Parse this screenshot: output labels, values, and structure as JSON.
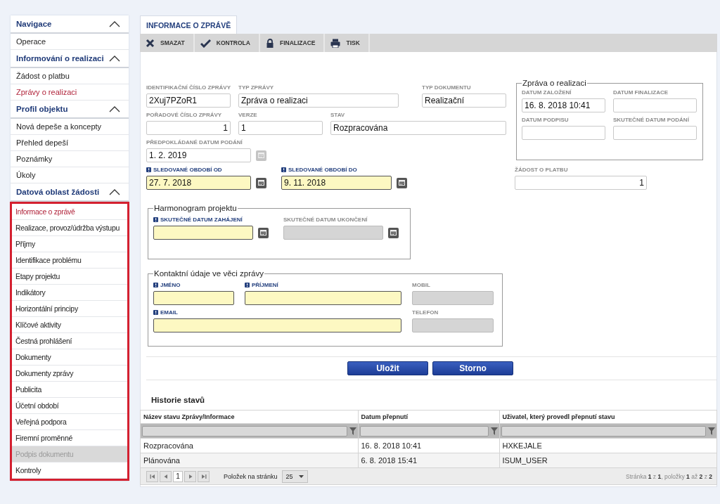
{
  "sidebar": {
    "sections": [
      {
        "title": "Navigace",
        "expanded": true,
        "highlighted": false,
        "items": [
          {
            "label": "Operace",
            "selected": false,
            "disabled": false
          }
        ]
      },
      {
        "title": "Informování o realizaci",
        "expanded": true,
        "highlighted": false,
        "items": [
          {
            "label": "Žádost o platbu",
            "selected": false,
            "disabled": false
          },
          {
            "label": "Zprávy o realizaci",
            "selected": true,
            "disabled": false
          }
        ]
      },
      {
        "title": "Profil objektu",
        "expanded": true,
        "highlighted": false,
        "items": [
          {
            "label": "Nová depeše a koncepty",
            "selected": false,
            "disabled": false
          },
          {
            "label": "Přehled depeší",
            "selected": false,
            "disabled": false
          },
          {
            "label": "Poznámky",
            "selected": false,
            "disabled": false
          },
          {
            "label": "Úkoly",
            "selected": false,
            "disabled": false
          }
        ]
      },
      {
        "title": "Datová oblast žádosti",
        "expanded": true,
        "highlighted": true,
        "items": [
          {
            "label": "Informace o zprávě",
            "selected": true,
            "disabled": false
          },
          {
            "label": "Realizace, provoz/údržba výstupu",
            "selected": false,
            "disabled": false
          },
          {
            "label": "Příjmy",
            "selected": false,
            "disabled": false
          },
          {
            "label": "Identifikace problému",
            "selected": false,
            "disabled": false
          },
          {
            "label": "Etapy projektu",
            "selected": false,
            "disabled": false
          },
          {
            "label": "Indikátory",
            "selected": false,
            "disabled": false
          },
          {
            "label": "Horizontální principy",
            "selected": false,
            "disabled": false
          },
          {
            "label": "Klíčové aktivity",
            "selected": false,
            "disabled": false
          },
          {
            "label": "Čestná prohlášení",
            "selected": false,
            "disabled": false
          },
          {
            "label": "Dokumenty",
            "selected": false,
            "disabled": false
          },
          {
            "label": "Dokumenty zprávy",
            "selected": false,
            "disabled": false
          },
          {
            "label": "Publicita",
            "selected": false,
            "disabled": false
          },
          {
            "label": "Účetní období",
            "selected": false,
            "disabled": false
          },
          {
            "label": "Veřejná podpora",
            "selected": false,
            "disabled": false
          },
          {
            "label": "Firemní proměnné",
            "selected": false,
            "disabled": false
          },
          {
            "label": "Podpis dokumentu",
            "selected": false,
            "disabled": true
          },
          {
            "label": "Kontroly",
            "selected": false,
            "disabled": false
          }
        ]
      }
    ]
  },
  "tabs": [
    {
      "label": "INFORMACE O ZPRÁVĚ",
      "selected": true
    }
  ],
  "toolbar": [
    {
      "label": "SMAZAT",
      "kind": "delete"
    },
    {
      "label": "KONTROLA",
      "kind": "check"
    },
    {
      "label": "FINALIZACE",
      "kind": "lock"
    },
    {
      "label": "TISK",
      "kind": "print"
    }
  ],
  "fields": {
    "id_number": {
      "label": "IDENTIFIKAČNÍ ČÍSLO ZPRÁVY",
      "value": "2Xuj7PZoR1",
      "required": false,
      "disabled": false,
      "right_aligned": false
    },
    "report_type": {
      "label": "TYP ZPRÁVY",
      "value": "Zpráva o realizaci",
      "required": false,
      "disabled": false,
      "right_aligned": false
    },
    "document_type": {
      "label": "TYP DOKUMENTU",
      "value": "Realizační",
      "required": false,
      "disabled": false,
      "right_aligned": false
    },
    "order_number": {
      "label": "POŘADOVÉ ČÍSLO ZPRÁVY",
      "value": "1",
      "required": false,
      "disabled": false,
      "right_aligned": true
    },
    "version": {
      "label": "VERZE",
      "value": "1",
      "required": false,
      "disabled": false,
      "right_aligned": false
    },
    "state": {
      "label": "STAV",
      "value": "Rozpracována",
      "required": false,
      "disabled": false,
      "right_aligned": false
    },
    "expected_date": {
      "label": "PŘEDPOKLÁDANÉ DATUM PODÁNÍ",
      "value": "1. 2. 2019",
      "required": false,
      "disabled": false,
      "right_aligned": false,
      "calendar": true,
      "calendar_enabled": false
    },
    "period_from": {
      "label": "SLEDOVANÉ OBDOBÍ OD",
      "value": "27. 7. 2018",
      "required": true,
      "disabled": false,
      "right_aligned": false,
      "calendar": true,
      "calendar_enabled": true
    },
    "period_to": {
      "label": "SLEDOVANÉ OBDOBÍ DO",
      "value": "9. 11. 2018",
      "required": true,
      "disabled": false,
      "right_aligned": false,
      "calendar": true,
      "calendar_enabled": true
    },
    "created": {
      "label": "DATUM ZALOŽENÍ",
      "value": "16. 8. 2018 10:41",
      "required": false,
      "disabled": false,
      "right_aligned": false
    },
    "finalized": {
      "label": "DATUM FINALIZACE",
      "required": false,
      "disabled": false
    },
    "signed": {
      "label": "DATUM PODPISU",
      "required": false,
      "disabled": false
    },
    "submitted": {
      "label": "SKUTEČNÉ DATUM PODÁNÍ",
      "required": false,
      "disabled": false
    },
    "payment_request": {
      "label": "ŽÁDOST O PLATBU",
      "value": "1",
      "required": false,
      "disabled": false,
      "right_aligned": true
    },
    "start_date": {
      "label": "SKUTEČNÉ DATUM ZAHÁJENÍ",
      "required": true,
      "disabled": false,
      "calendar": true,
      "calendar_enabled": true
    },
    "end_date": {
      "label": "SKUTEČNÉ DATUM UKONČENÍ",
      "required": false,
      "disabled": true,
      "calendar": true,
      "calendar_enabled": true
    },
    "first_name": {
      "label": "JMÉNO",
      "required": true,
      "disabled": false
    },
    "last_name": {
      "label": "PŘÍJMENÍ",
      "required": true,
      "disabled": false
    },
    "mobile": {
      "label": "MOBIL",
      "required": false,
      "disabled": true
    },
    "email": {
      "label": "EMAIL",
      "required": true,
      "disabled": false
    },
    "phone": {
      "label": "TELEFON",
      "required": false,
      "disabled": true
    }
  },
  "groups": {
    "report": "Zpráva o realizaci",
    "schedule": "Harmonogram projektu",
    "contact": "Kontaktní údaje ve věci zprávy"
  },
  "buttons": [
    "Uložit",
    "Storno"
  ],
  "history": {
    "title": "Historie stavů",
    "columns": [
      "Název stavu Zprávy/Informace",
      "Datum přepnutí",
      "Uživatel, který provedl přepnutí stavu"
    ],
    "rows": [
      [
        "Rozpracována",
        "16. 8. 2018 10:41",
        "HXKEJALE"
      ],
      [
        "Plánována",
        "6. 8. 2018 15:41",
        "ISUM_USER"
      ]
    ],
    "pager": {
      "page": "1",
      "per_page_label": "Položek na stránku",
      "per_page": "25",
      "summary": "Stránka **1** z **1**, položky **1** až **2** z **2**"
    }
  }
}
